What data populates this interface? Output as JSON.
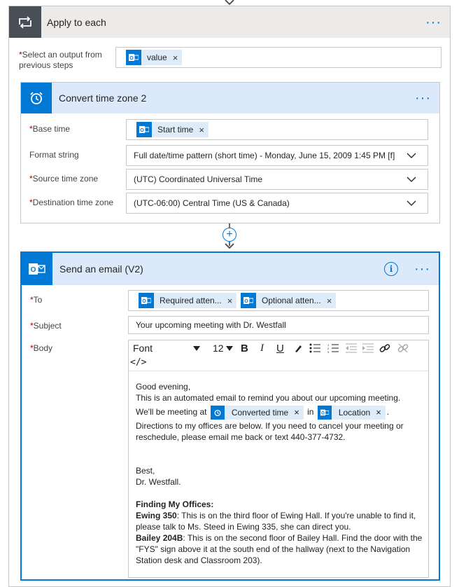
{
  "apply_each": {
    "title": "Apply to each",
    "select_label": "Select an output from previous steps",
    "select_required": "*",
    "token": "value"
  },
  "convert": {
    "title": "Convert time zone 2",
    "base_time_label": "Base time",
    "base_time_token": "Start time",
    "format_label": "Format string",
    "format_value": "Full date/time pattern (short time) - Monday, June 15, 2009 1:45 PM [f]",
    "source_label": "Source time zone",
    "source_value": "(UTC) Coordinated Universal Time",
    "dest_label": "Destination time zone",
    "dest_value": "(UTC-06:00) Central Time (US & Canada)"
  },
  "email": {
    "title": "Send an email (V2)",
    "info": "i",
    "to_label": "To",
    "to_tokens": [
      "Required atten...",
      "Optional atten..."
    ],
    "subject_label": "Subject",
    "subject_value": "Your upcoming meeting with Dr. Westfall",
    "body_label": "Body",
    "toolbar": {
      "font": "Font",
      "size": "12",
      "bold": "B",
      "italic": "I",
      "underline": "U",
      "code": "</>"
    },
    "body": {
      "line1": "Good evening,",
      "line2": "This is an automated email to remind you about our upcoming meeting.",
      "line3_pre": "We'll be meeting at",
      "token_time": "Converted time",
      "line3_mid": "in",
      "token_location": "Location",
      "line3_post": ".",
      "line4": "Directions to my offices are below. If you need to cancel your meeting or reschedule, please email me back or text 440-377-4732.",
      "sign1": "Best,",
      "sign2": "Dr. Westfall.",
      "heading": "Finding My Offices:",
      "ewing_bold": "Ewing 350",
      "ewing_text": ": This is on the third floor of Ewing Hall. If you're unable to find it, please talk to Ms. Steed in Ewing 335, she can direct you.",
      "bailey_bold": "Bailey 204B",
      "bailey_text": ": This is on the second floor of Bailey Hall. Find the door with the \"FYS\" sign above it at the south end of the hallway (next to the Navigation Station desk and Classroom 203)."
    }
  },
  "ui": {
    "required_mark": "*",
    "more_dots": "···",
    "remove_x": "×",
    "plus": "+"
  },
  "colors": {
    "accent": "#0078d4",
    "header_gray": "#edebe9",
    "header_blue": "#dbe9fb",
    "token_bg": "#deecf9",
    "required": "#a80000"
  }
}
